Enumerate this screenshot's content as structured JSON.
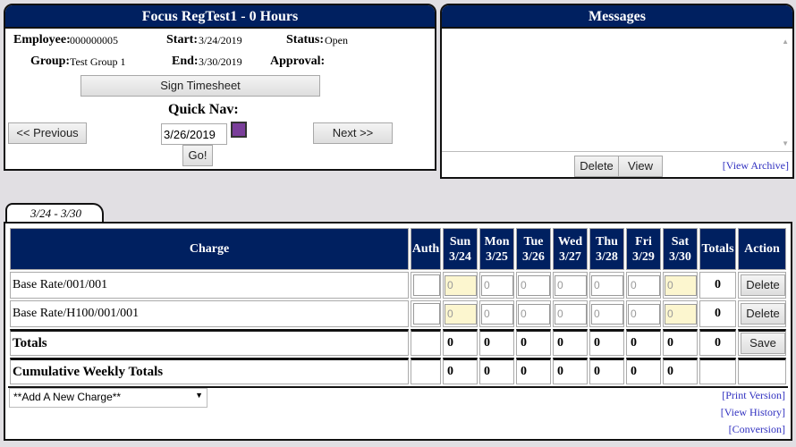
{
  "timesheet": {
    "title": "Focus RegTest1 - 0 Hours",
    "employee_label": "Employee:",
    "employee": "000000005",
    "start_label": "Start:",
    "start": "3/24/2019",
    "status_label": "Status:",
    "status": "Open",
    "group_label": "Group:",
    "group": "Test Group 1",
    "end_label": "End:",
    "end": "3/30/2019",
    "approval_label": "Approval:",
    "sign_button": "Sign Timesheet",
    "quicknav_label": "Quick Nav:",
    "quicknav_date": "3/26/2019",
    "previous_button": "<< Previous",
    "next_button": "Next >>",
    "go_button": "Go!"
  },
  "messages": {
    "title": "Messages",
    "delete_button": "Delete",
    "view_button": "View",
    "archive_link": "[View Archive]"
  },
  "tab": "3/24 - 3/30",
  "grid": {
    "headers": {
      "charge": "Charge",
      "auth": "Auth",
      "totals": "Totals",
      "action": "Action",
      "days": [
        {
          "d": "Sun",
          "date": "3/24"
        },
        {
          "d": "Mon",
          "date": "3/25"
        },
        {
          "d": "Tue",
          "date": "3/26"
        },
        {
          "d": "Wed",
          "date": "3/27"
        },
        {
          "d": "Thu",
          "date": "3/28"
        },
        {
          "d": "Fri",
          "date": "3/29"
        },
        {
          "d": "Sat",
          "date": "3/30"
        }
      ]
    },
    "rows": [
      {
        "charge": "Base Rate/001/001",
        "values": [
          "0",
          "0",
          "0",
          "0",
          "0",
          "0",
          "0"
        ],
        "total": "0",
        "action": "Delete"
      },
      {
        "charge": "Base Rate/H100/001/001",
        "values": [
          "0",
          "0",
          "0",
          "0",
          "0",
          "0",
          "0"
        ],
        "total": "0",
        "action": "Delete"
      }
    ],
    "totals": {
      "label": "Totals",
      "values": [
        "0",
        "0",
        "0",
        "0",
        "0",
        "0",
        "0"
      ],
      "total": "0",
      "action": "Save"
    },
    "cumulative": {
      "label": "Cumulative Weekly Totals",
      "values": [
        "0",
        "0",
        "0",
        "0",
        "0",
        "0",
        "0"
      ]
    }
  },
  "add_charge": "**Add A New Charge**",
  "links": {
    "print": "[Print Version]",
    "history": "[View History]",
    "conversion": "[Conversion]"
  }
}
